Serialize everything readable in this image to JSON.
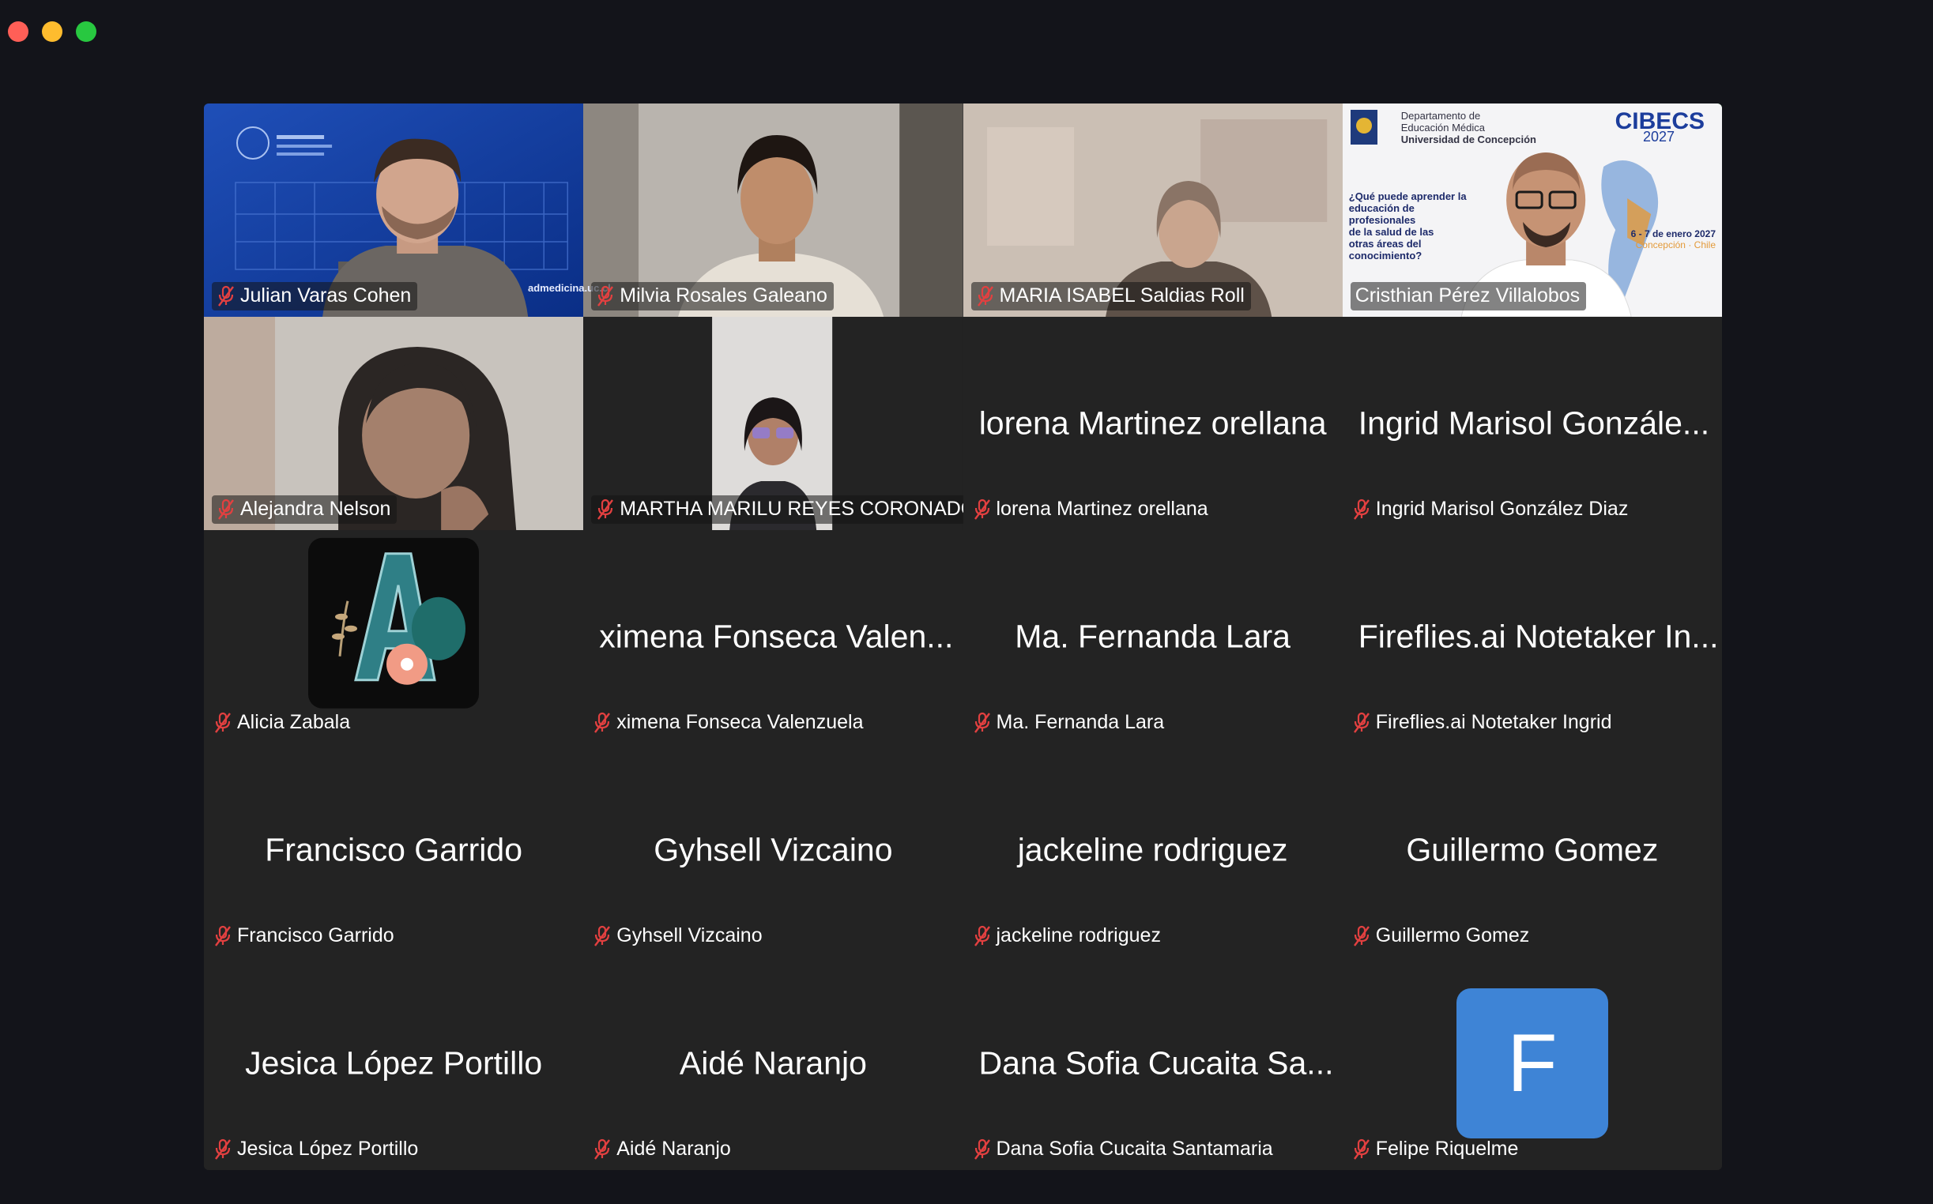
{
  "window": {
    "controls": {
      "close_color": "#ff5f57",
      "minimize_color": "#febc2e",
      "zoom_color": "#28c840"
    }
  },
  "gallery": {
    "accent_active_speaker": "#3ed13e",
    "muted_icon": "mic-off-icon",
    "participants": [
      {
        "name": "Julian Varas Cohen",
        "display": "",
        "video": true,
        "bg_text": "admedicina.uc.cl"
      },
      {
        "name": "Milvia Rosales Galeano",
        "display": "",
        "video": true
      },
      {
        "name": "MARIA ISABEL Saldias Roll",
        "display": "",
        "video": true
      },
      {
        "name": "Cristhian Pérez Villalobos",
        "display": "",
        "video": true,
        "active": true,
        "bg_lines": [
          "Departamento de",
          "Educación Médica",
          "Universidad de Concepción",
          "CIBECS",
          "2027",
          "¿Qué puede aprender la",
          "educación de",
          "profesionales",
          "de la salud de las",
          "otras áreas del",
          "conocimiento?",
          "6 - 7 de enero 2027",
          "Concepción · Chile"
        ]
      },
      {
        "name": "Alejandra Nelson",
        "display": "",
        "video": true
      },
      {
        "name": "MARTHA MARILU REYES CORONADO",
        "display": "",
        "video": true
      },
      {
        "name": "lorena Martinez orellana",
        "display": "lorena Martinez orellana"
      },
      {
        "name": "Ingrid Marisol González Diaz",
        "display": "Ingrid Marisol Gonzále..."
      },
      {
        "name": "Alicia Zabala",
        "display": "",
        "avatar": "letter-a-floral-icon"
      },
      {
        "name": "ximena Fonseca Valenzuela",
        "display": "ximena Fonseca Valen..."
      },
      {
        "name": "Ma. Fernanda Lara",
        "display": "Ma. Fernanda Lara"
      },
      {
        "name": "Fireflies.ai Notetaker Ingrid",
        "display": "Fireflies.ai Notetaker In..."
      },
      {
        "name": "Francisco Garrido",
        "display": "Francisco Garrido"
      },
      {
        "name": "Gyhsell Vizcaino",
        "display": "Gyhsell Vizcaino"
      },
      {
        "name": "jackeline rodriguez",
        "display": "jackeline rodriguez"
      },
      {
        "name": "Guillermo Gomez",
        "display": "Guillermo Gomez"
      },
      {
        "name": "Jesica López Portillo",
        "display": "Jesica López Portillo"
      },
      {
        "name": "Aidé Naranjo",
        "display": "Aidé Naranjo"
      },
      {
        "name": "Dana Sofia Cucaita Santamaria",
        "display": "Dana Sofia Cucaita Sa..."
      },
      {
        "name": "Felipe Riquelme",
        "display": "",
        "avatar_letter": "F",
        "avatar_color": "#3e84d6"
      }
    ]
  }
}
